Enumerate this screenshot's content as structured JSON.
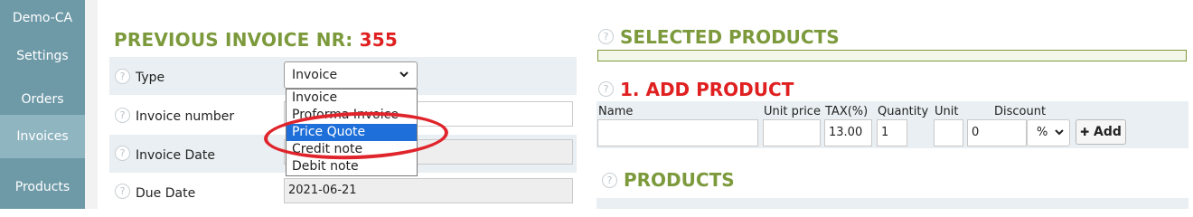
{
  "sidebar": {
    "items": [
      {
        "label": "Demo-CA"
      },
      {
        "label": "Settings"
      },
      {
        "label": "Orders"
      },
      {
        "label": "Invoices"
      },
      {
        "label": "Products"
      }
    ]
  },
  "form": {
    "title_prefix": "PREVIOUS INVOICE NR:",
    "invoice_nr": "355",
    "help_glyph": "?",
    "rows": [
      {
        "label": "Type"
      },
      {
        "label": "Invoice number"
      },
      {
        "label": "Invoice Date"
      },
      {
        "label": "Due Date"
      }
    ],
    "type_select": {
      "selected": "Invoice",
      "chevron": "⌵"
    },
    "due_date": "2021-06-21",
    "dropdown_options": [
      "Invoice",
      "Proforma Invoice",
      "Price Quote",
      "Credit note",
      "Debit note"
    ],
    "highlighted_option": "Price Quote"
  },
  "right": {
    "selected_products_title": "SELECTED PRODUCTS",
    "add_product_title": "1. ADD PRODUCT",
    "products_title": "PRODUCTS",
    "columns": {
      "name": "Name",
      "unit_price": "Unit price",
      "tax": "TAX(%)",
      "quantity": "Quantity",
      "unit": "Unit",
      "discount": "Discount"
    },
    "values": {
      "tax": "13.00",
      "quantity": "1",
      "discount": "0",
      "discount_type": "%"
    },
    "add_button": "Add",
    "add_icon": "✚"
  },
  "colors": {
    "sidebar": "#6e9aa8",
    "sidebar_active": "#8fb5c1",
    "title_green": "#7c9a3c",
    "title_red": "#e02020",
    "highlight": "#1e6fd9",
    "annotation": "#e0242b"
  }
}
